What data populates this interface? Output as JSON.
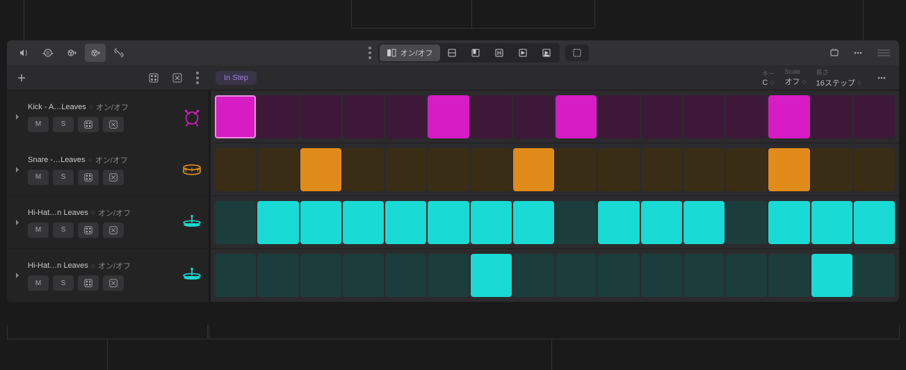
{
  "toolbar": {
    "mode_onoff_label": "オン/オフ"
  },
  "header": {
    "chip_label": "In Step",
    "params": {
      "key": {
        "label": "キー",
        "value": "C"
      },
      "scale": {
        "label": "Scale",
        "value": "オフ"
      },
      "length": {
        "label": "長さ",
        "value": "16ステップ"
      }
    }
  },
  "rows": [
    {
      "name": "Kick - A…Leaves",
      "mode": "オン/オフ",
      "color": "kick",
      "m": "M",
      "s": "S",
      "steps": [
        1,
        0,
        0,
        0,
        0,
        1,
        0,
        0,
        1,
        0,
        0,
        0,
        0,
        1,
        0,
        0
      ],
      "selected": 0
    },
    {
      "name": "Snare -…Leaves",
      "mode": "オン/オフ",
      "color": "snare",
      "m": "M",
      "s": "S",
      "steps": [
        0,
        0,
        1,
        0,
        0,
        0,
        0,
        1,
        0,
        0,
        0,
        0,
        0,
        1,
        0,
        0
      ]
    },
    {
      "name": "Hi-Hat…n Leaves",
      "mode": "オン/オフ",
      "color": "hihat",
      "m": "M",
      "s": "S",
      "steps": [
        0,
        1,
        1,
        1,
        1,
        1,
        1,
        1,
        0,
        1,
        1,
        1,
        0,
        1,
        1,
        1
      ]
    },
    {
      "name": "Hi-Hat…n Leaves",
      "mode": "オン/オフ",
      "color": "hihat",
      "m": "M",
      "s": "S",
      "steps": [
        0,
        0,
        0,
        0,
        0,
        0,
        1,
        0,
        0,
        0,
        0,
        0,
        0,
        0,
        1,
        0
      ]
    }
  ]
}
